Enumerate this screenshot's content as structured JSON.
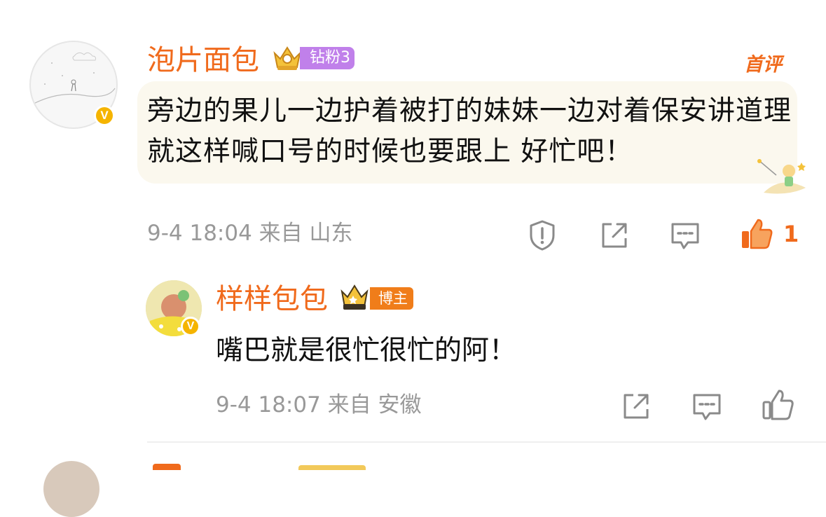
{
  "comment": {
    "username": "泡片面包",
    "fan_badge": "钻粉3",
    "first_comment_tag": "首评",
    "text": "旁边的果儿一边护着被打的妹妹一边对着保安讲道理就这样喊口号的时候也要跟上 好忙吧！",
    "timestamp": "9-4 18:04",
    "location": "来自 山东",
    "meta": "9-4 18:04 来自 山东",
    "like_count": "1",
    "verified_badge": "V"
  },
  "reply": {
    "username": "样样包包",
    "blogger_badge": "博主",
    "text": "嘴巴就是很忙很忙的阿！",
    "meta": "9-4 18:07 来自 安徽",
    "verified_badge": "V"
  },
  "icons": {
    "report": "report-icon",
    "share": "share-icon",
    "comment": "comment-icon",
    "like": "like-icon"
  },
  "colors": {
    "accent": "#f06a1c",
    "fan_badge_bg": "#c080ea",
    "blogger_badge_bg": "#f07d1a",
    "bubble_bg": "#fbf8ee",
    "meta_text": "#999999"
  }
}
